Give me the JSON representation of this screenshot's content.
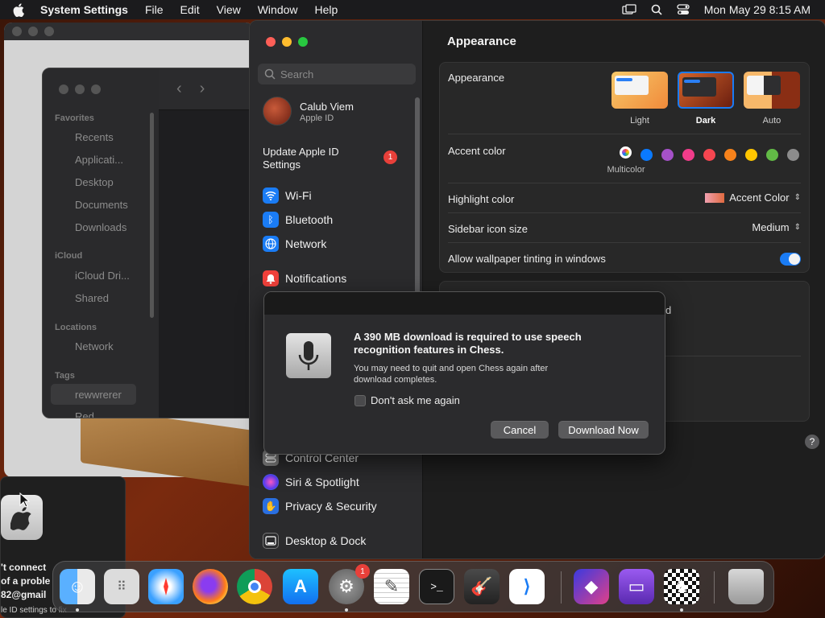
{
  "menubar": {
    "app": "System Settings",
    "items": [
      "File",
      "Edit",
      "View",
      "Window",
      "Help"
    ],
    "clock": "Mon May 29  8:15 AM"
  },
  "finder": {
    "favorites_header": "Favorites",
    "favorites": [
      "Recents",
      "Applicati...",
      "Desktop",
      "Documents",
      "Downloads"
    ],
    "icloud_header": "iCloud",
    "icloud": [
      "iCloud Dri...",
      "Shared"
    ],
    "locations_header": "Locations",
    "locations": [
      "Network"
    ],
    "tags_header": "Tags",
    "tags": [
      "rewwrerer",
      "Red"
    ]
  },
  "settings": {
    "search_placeholder": "Search",
    "user": {
      "name": "Calub Viem",
      "sub": "Apple ID"
    },
    "update": {
      "label": "Update Apple ID Settings",
      "badge": "1"
    },
    "sidebar": [
      {
        "label": "Wi-Fi",
        "color": "#1a7cf5",
        "icon": "wifi-icon"
      },
      {
        "label": "Bluetooth",
        "color": "#1a7cf5",
        "icon": "bluetooth-icon"
      },
      {
        "label": "Network",
        "color": "#1a7cf5",
        "icon": "globe-icon"
      },
      {
        "label": "Notifications",
        "color": "#f0413b",
        "icon": "bell-icon"
      },
      {
        "label": "Control Center",
        "color": "#7a7a7a",
        "icon": "control-center-icon"
      },
      {
        "label": "Siri & Spotlight",
        "color": "#b040d0",
        "icon": "siri-icon"
      },
      {
        "label": "Privacy & Security",
        "color": "#2a6fe0",
        "icon": "hand-icon"
      },
      {
        "label": "Desktop & Dock",
        "color": "#2c2c2e",
        "icon": "dock-icon"
      }
    ],
    "page_title": "Appearance",
    "appearance": {
      "label": "Appearance",
      "options": [
        "Light",
        "Dark",
        "Auto"
      ],
      "selected": "Dark"
    },
    "accent": {
      "label": "Accent color",
      "caption": "Multicolor",
      "colors": [
        "#0a7aff",
        "#a551c8",
        "#f03c8a",
        "#f54650",
        "#f7821b",
        "#ffc600",
        "#62ba46",
        "#8c8c8c"
      ]
    },
    "highlight": {
      "label": "Highlight color",
      "value": "Accent Color"
    },
    "sidebar_icon": {
      "label": "Sidebar icon size",
      "value": "Medium"
    },
    "tinting": {
      "label": "Allow wallpaper tinting in windows",
      "on": true
    },
    "hidden_text": "d"
  },
  "dialog": {
    "title": "A 390 MB download is required to use speech recognition features in Chess.",
    "body": "You may need to quit and open Chess again after download completes.",
    "checkbox": "Don't ask me again",
    "cancel": "Cancel",
    "confirm": "Download Now"
  },
  "notification": {
    "lines": [
      "'t connect",
      "of a proble",
      "82@gmail",
      "le ID settings to fix"
    ]
  },
  "dock": {
    "settings_badge": "1"
  }
}
